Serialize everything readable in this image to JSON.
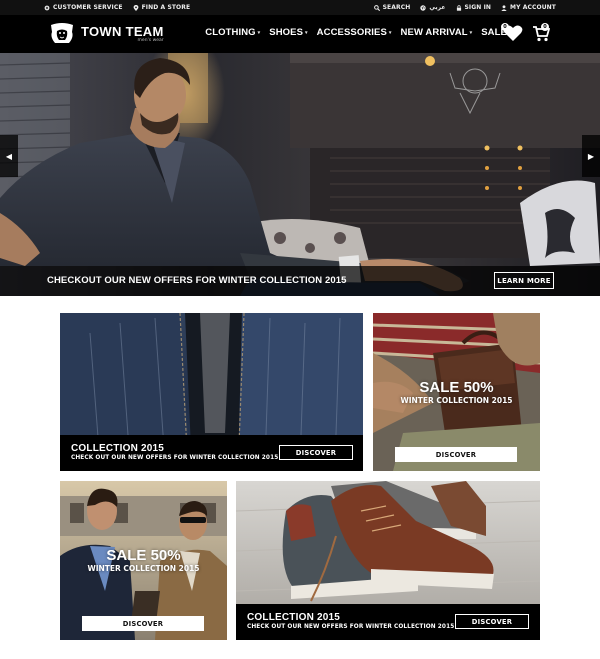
{
  "topbar": {
    "customer_service": "CUSTOMER SERVICE",
    "find_store": "FIND A STORE",
    "search": "SEARCH",
    "language": "عربي",
    "sign_in": "SIGN IN",
    "my_account": "MY ACCOUNT"
  },
  "header": {
    "logo_title": "TOWN TEAM",
    "logo_subtitle": "men's wear",
    "nav": [
      {
        "label": "CLOTHING",
        "caret": "▾"
      },
      {
        "label": "SHOES",
        "caret": "▾"
      },
      {
        "label": "ACCESSORIES",
        "caret": "▾"
      },
      {
        "label": "NEW ARRIVAL",
        "caret": "▾"
      },
      {
        "label": "SALE"
      }
    ],
    "wishlist_count": "0",
    "cart_count": "0"
  },
  "hero": {
    "caption": "CHECKOUT OUR NEW OFFERS FOR WINTER COLLECTION 2015",
    "button": "LEARN MORE",
    "prev_icon": "chevron-left-icon",
    "next_icon": "chevron-right-icon"
  },
  "tiles": [
    {
      "title": "COLLECTION 2015",
      "subtitle": "CHECK OUT OUR NEW OFFERS FOR WINTER COLLECTION 2015",
      "button": "DISCOVER"
    },
    {
      "title": "SALE 50%",
      "subtitle": "WINTER COLLECTION 2015",
      "button": "DISCOVER"
    },
    {
      "title": "SALE 50%",
      "subtitle": "WINTER COLLECTION 2015",
      "button": "DISCOVER"
    },
    {
      "title": "COLLECTION 2015",
      "subtitle": "CHECK OUT OUR NEW OFFERS FOR WINTER COLLECTION 2015",
      "button": "DISCOVER"
    }
  ],
  "colors": {
    "bar": "#111111",
    "header": "#000000",
    "accent": "#ffffff"
  }
}
